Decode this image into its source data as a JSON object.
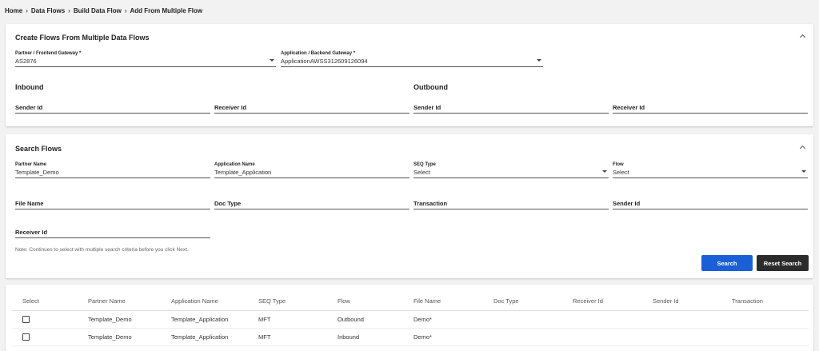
{
  "breadcrumb": [
    "Home",
    "Data Flows",
    "Build Data Flow",
    "Add From Multiple Flow"
  ],
  "create": {
    "title": "Create Flows From Multiple Data Flows",
    "partner_label": "Partner / Frontend Gateway *",
    "partner_value": "AS2876",
    "app_label": "Application / Backend Gateway *",
    "app_value": "ApplicationAWSS312609126094",
    "inbound_title": "Inbound",
    "outbound_title": "Outbound",
    "inbound_sender": "Sender Id",
    "inbound_receiver": "Receiver Id",
    "outbound_sender": "Sender Id",
    "outbound_receiver": "Receiver Id"
  },
  "search": {
    "title": "Search Flows",
    "partner_name_label": "Partner Name",
    "partner_name_value": "Template_Demo",
    "app_name_label": "Application Name",
    "app_name_value": "Template_Application",
    "seq_type_label": "SEQ Type",
    "seq_type_value": "Select",
    "flow_label": "Flow",
    "flow_value": "Select",
    "file_name": "File Name",
    "doc_type": "Doc Type",
    "transaction": "Transaction",
    "sender_id": "Sender Id",
    "receiver_id": "Receiver Id",
    "note": "Note: Continues to select with multiple search criteria before you click Next.",
    "search_button": "Search",
    "reset_button": "Reset Search"
  },
  "results": {
    "columns": [
      "Select",
      "Partner Name",
      "Application Name",
      "SEQ Type",
      "Flow",
      "File Name",
      "Doc Type",
      "Receiver Id",
      "Sender Id",
      "Transaction"
    ],
    "rows": [
      {
        "partner": "Template_Demo",
        "application": "Template_Application",
        "seq": "MFT",
        "flow": "Outbound",
        "file": "Demo*",
        "doc": "",
        "receiver": "",
        "sender": "",
        "transaction": "",
        "checked": false
      },
      {
        "partner": "Template_Demo",
        "application": "Template_Application",
        "seq": "MFT",
        "flow": "Inbound",
        "file": "Demo*",
        "doc": "",
        "receiver": "",
        "sender": "",
        "transaction": "",
        "checked": false
      }
    ]
  },
  "colors": {
    "primary_button": "#1a5fd6",
    "secondary_button": "#2b2b2b",
    "page_background": "#f2f2f2"
  }
}
